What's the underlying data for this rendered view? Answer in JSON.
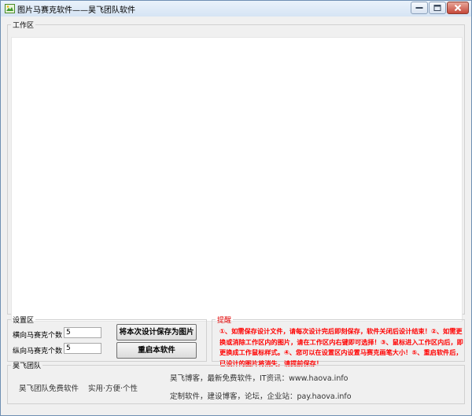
{
  "window": {
    "title": "图片马赛克软件——昊飞团队软件"
  },
  "work_area": {
    "legend": "工作区"
  },
  "settings": {
    "legend": "设置区",
    "horizontal_label": "横向马赛克个数",
    "horizontal_value": "5",
    "vertical_label": "纵向马赛克个数",
    "vertical_value": "5",
    "save_button": "将本次设计保存为图片",
    "restart_button": "重启本软件"
  },
  "tips": {
    "legend": "提醒",
    "text": "①、如需保存设计文件，请每次设计完后即刻保存，软件关闭后设计结束！②、如需更换或消除工作区内的图片，请在工作区内右键即可选择！③、鼠标进入工作区内后，即更换成工作鼠标样式。④、您可以在设置区内设置马赛克画笔大小！⑤、重启软件后，已设计的图片将消失，请提前保存！"
  },
  "team": {
    "legend": "昊飞团队",
    "slogan_left": "昊飞团队免费软件",
    "slogan_right": "实用·方便·个性",
    "line1": "昊飞博客，最新免费软件，IT资讯：www.haova.info",
    "line2": "定制软件，建设博客，论坛，企业站：pay.haova.info"
  },
  "icons": {
    "app": "image-app-icon",
    "minimize": "minimize-icon",
    "maximize": "maximize-icon",
    "close": "close-icon"
  },
  "colors": {
    "tips_text": "#ff0000",
    "title_bar": "#dbe7f5",
    "close_button": "#c5483a"
  }
}
